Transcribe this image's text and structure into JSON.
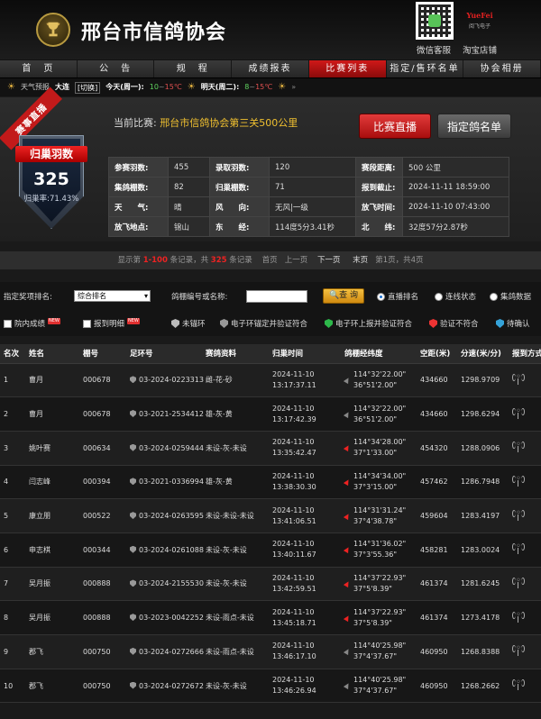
{
  "header": {
    "title": "邢台市信鸽协会",
    "qr_label": "微信客服",
    "shop_logo_text": "YueFei",
    "shop_logo_sub": "阅飞电子",
    "shop_label": "淘宝店铺"
  },
  "nav": [
    "首　页",
    "公　告",
    "规　程",
    "成绩报表",
    "比赛列表",
    "指定/售环名单",
    "协会相册"
  ],
  "nav_active": 4,
  "weather": {
    "label": "天气预报",
    "city": "大连",
    "switch": "[切换]",
    "today_label": "今天(周一):",
    "today_hi": "10",
    "today_sep": "~",
    "today_lo": "15℃",
    "today_icon": "晴",
    "tomorrow_label": "明天(周二):",
    "tomorrow_hi": "8",
    "tomorrow_sep": "~",
    "tomorrow_lo": "15℃",
    "tomorrow_icon": "晴",
    "more": "»"
  },
  "race": {
    "ribbon": "赛事直播",
    "badge_title": "归巢羽数",
    "badge_count": "325",
    "badge_rate": "归巢率:71.43%",
    "current_label": "当前比赛:",
    "current_name": "邢台市信鸽协会第三关500公里",
    "btn_live": "比赛直播",
    "btn_list": "指定鸽名单",
    "info": [
      [
        {
          "k": "参赛羽数:",
          "v": "455"
        },
        {
          "k": "录取羽数:",
          "v": "120"
        },
        {
          "k": "赛段距离:",
          "v": "500 公里"
        }
      ],
      [
        {
          "k": "集鸽棚数:",
          "v": "82"
        },
        {
          "k": "归巢棚数:",
          "v": "71"
        },
        {
          "k": "报到截止:",
          "v": "2024-11-11 18:59:00"
        }
      ],
      [
        {
          "k": "天　　气:",
          "v": "晴"
        },
        {
          "k": "风　　向:",
          "v": "无风|一级"
        },
        {
          "k": "放飞时间:",
          "v": "2024-11-10 07:43:00"
        }
      ],
      [
        {
          "k": "放飞地点:",
          "v": "锦山"
        },
        {
          "k": "东　　经:",
          "v": "114度5分3.41秒"
        },
        {
          "k": "北　　纬:",
          "v": "32度57分2.87秒"
        }
      ]
    ]
  },
  "paging": {
    "pre": "显示第",
    "range": "1-100",
    "mid": "条记录，共",
    "total": "325",
    "post": "条记录",
    "first": "首页",
    "prev": "上一页",
    "next": "下一页",
    "last": "末页",
    "page_info": "第1页，共4页"
  },
  "filters": {
    "award_label": "指定奖项排名:",
    "award_value": "综合排名",
    "search_label": "鸽棚编号或名称:",
    "search_value": "",
    "query_btn": "查 询",
    "radios": [
      "直播排名",
      "连线状态",
      "集鸽数据"
    ],
    "radio_selected": 0,
    "check_yard": "院内成绩",
    "check_note": "报到明细",
    "new_tag": "NEW",
    "legend": [
      "未锚环",
      "电子环锚定并验证符合",
      "电子环上报并验证符合",
      "验证不符合",
      "待确认"
    ]
  },
  "table": {
    "headers": [
      "名次",
      "姓名",
      "棚号",
      "足环号",
      "赛鸽资料",
      "归巢时间",
      "鸽棚经纬度",
      "空距(米)",
      "分速(米/分)",
      "报到方式"
    ],
    "rows": [
      {
        "rank": "1",
        "name": "曹月",
        "shed": "000678",
        "ring": "03-2024-0223313",
        "info": "雌-花-砂",
        "date": "2024-11-10",
        "time": "13:17:37.11",
        "lon": "114°32'22.00\"",
        "lat": "36°51'2.00\"",
        "dist": "434660",
        "speed": "1298.9709",
        "arrow": "gray"
      },
      {
        "rank": "2",
        "name": "曹月",
        "shed": "000678",
        "ring": "03-2021-2534412",
        "info": "雄-灰-黄",
        "date": "2024-11-10",
        "time": "13:17:42.39",
        "lon": "114°32'22.00\"",
        "lat": "36°51'2.00\"",
        "dist": "434660",
        "speed": "1298.6294",
        "arrow": "gray"
      },
      {
        "rank": "3",
        "name": "姚叶赛",
        "shed": "000634",
        "ring": "03-2024-0259444",
        "info": "未设-灰-未设",
        "date": "2024-11-10",
        "time": "13:35:42.47",
        "lon": "114°34'28.00\"",
        "lat": "37°1'33.00\"",
        "dist": "454320",
        "speed": "1288.0906",
        "arrow": "red"
      },
      {
        "rank": "4",
        "name": "闫志峰",
        "shed": "000394",
        "ring": "03-2021-0336994",
        "info": "雄-灰-黄",
        "date": "2024-11-10",
        "time": "13:38:30.30",
        "lon": "114°34'34.00\"",
        "lat": "37°3'15.00\"",
        "dist": "457462",
        "speed": "1286.7948",
        "arrow": "red"
      },
      {
        "rank": "5",
        "name": "康立朋",
        "shed": "000522",
        "ring": "03-2024-0263595",
        "info": "未设-未设-未设",
        "date": "2024-11-10",
        "time": "13:41:06.51",
        "lon": "114°31'31.24\"",
        "lat": "37°4'38.78\"",
        "dist": "459604",
        "speed": "1283.4197",
        "arrow": "red"
      },
      {
        "rank": "6",
        "name": "申志棋",
        "shed": "000344",
        "ring": "03-2024-0261088",
        "info": "未设-灰-未设",
        "date": "2024-11-10",
        "time": "13:40:11.67",
        "lon": "114°31'36.02\"",
        "lat": "37°3'55.36\"",
        "dist": "458281",
        "speed": "1283.0024",
        "arrow": "red"
      },
      {
        "rank": "7",
        "name": "吴月振",
        "shed": "000888",
        "ring": "03-2024-2155530",
        "info": "未设-灰-未设",
        "date": "2024-11-10",
        "time": "13:42:59.51",
        "lon": "114°37'22.93\"",
        "lat": "37°5'8.39\"",
        "dist": "461374",
        "speed": "1281.6245",
        "arrow": "red"
      },
      {
        "rank": "8",
        "name": "吴月振",
        "shed": "000888",
        "ring": "03-2023-0042252",
        "info": "未设-雨点-未设",
        "date": "2024-11-10",
        "time": "13:45:18.71",
        "lon": "114°37'22.93\"",
        "lat": "37°5'8.39\"",
        "dist": "461374",
        "speed": "1273.4178",
        "arrow": "red"
      },
      {
        "rank": "9",
        "name": "郡飞",
        "shed": "000750",
        "ring": "03-2024-0272666",
        "info": "未设-雨点-未设",
        "date": "2024-11-10",
        "time": "13:46:17.10",
        "lon": "114°40'25.98\"",
        "lat": "37°4'37.67\"",
        "dist": "460950",
        "speed": "1268.8388",
        "arrow": "gray"
      },
      {
        "rank": "10",
        "name": "郡飞",
        "shed": "000750",
        "ring": "03-2024-0272672",
        "info": "未设-灰-未设",
        "date": "2024-11-10",
        "time": "13:46:26.94",
        "lon": "114°40'25.98\"",
        "lat": "37°4'37.67\"",
        "dist": "460950",
        "speed": "1268.2662",
        "arrow": "gray"
      }
    ]
  },
  "colors": {
    "accent": "#c81414",
    "gold": "#f0c030",
    "background": "#1a1a1a"
  }
}
